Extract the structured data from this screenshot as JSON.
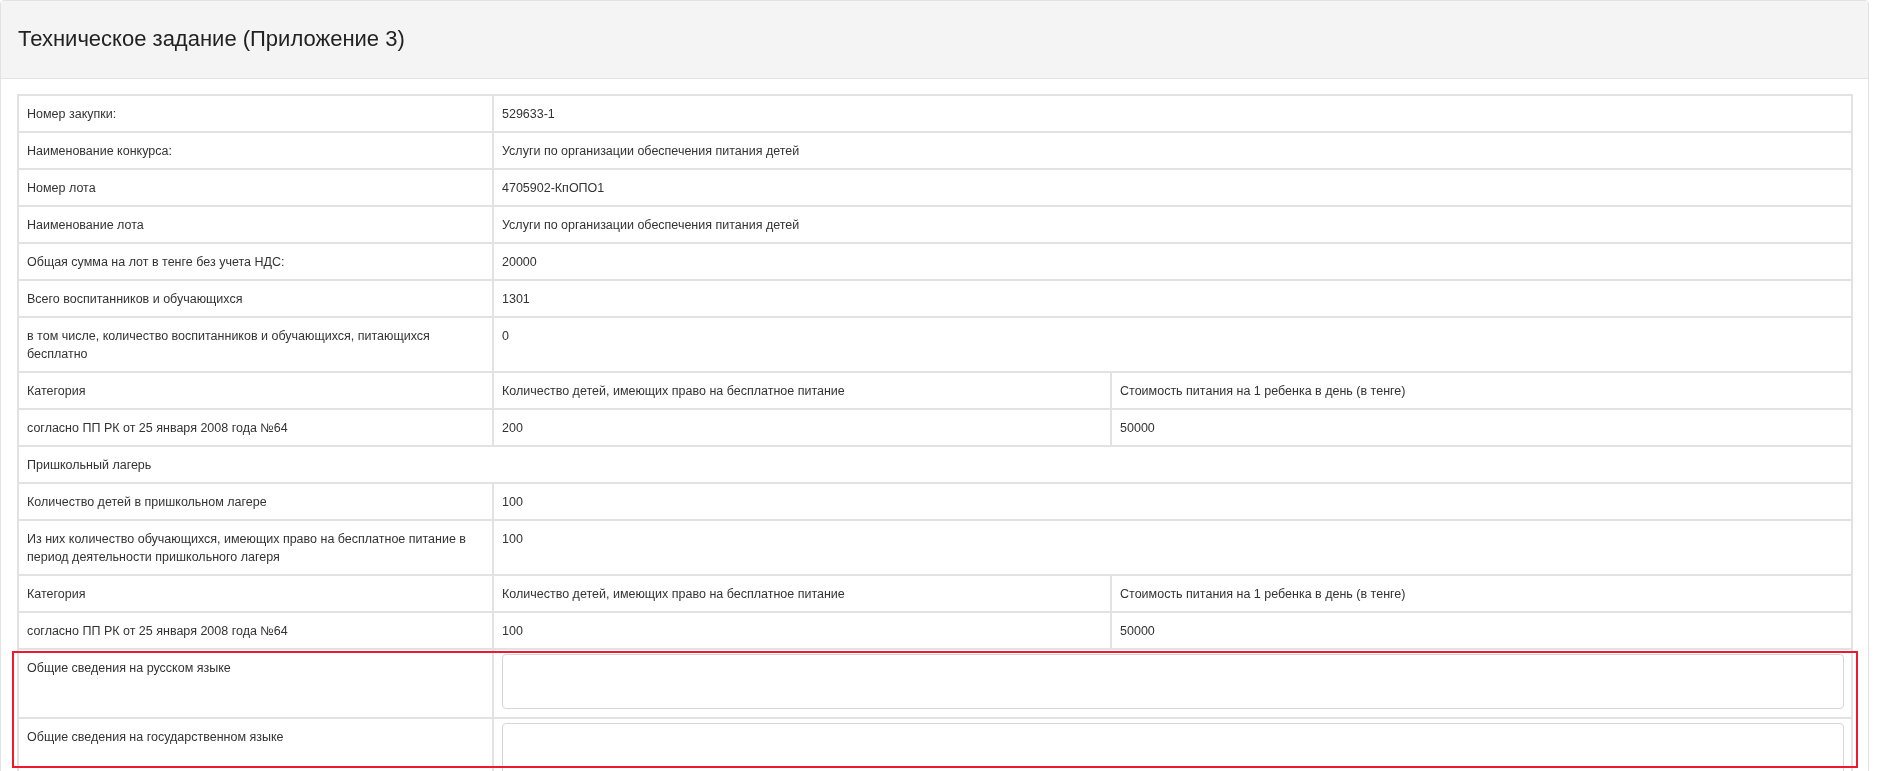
{
  "card": {
    "title": "Техническое задание (Приложение 3)"
  },
  "rows": [
    {
      "kind": "pair",
      "cells": [
        "Номер закупки:",
        "529633-1"
      ]
    },
    {
      "kind": "pair",
      "cells": [
        "Наименование конкурса:",
        "Услуги по организации обеспечения питания детей"
      ]
    },
    {
      "kind": "pair",
      "cells": [
        "Номер лота",
        "4705902-КпОПО1"
      ]
    },
    {
      "kind": "pair",
      "cells": [
        "Наименование лота",
        "Услуги по организации обеспечения питания детей"
      ]
    },
    {
      "kind": "pair",
      "cells": [
        "Общая сумма на лот в тенге без учета НДС:",
        "20000"
      ]
    },
    {
      "kind": "pair",
      "cells": [
        "Всего воспитанников и обучающихся",
        "1301"
      ]
    },
    {
      "kind": "pair",
      "cells": [
        "в том числе, количество воспитанников и обучающихся, питающихся бесплатно",
        "0"
      ]
    },
    {
      "kind": "triple",
      "cells": [
        "Категория",
        "Количество детей, имеющих право на бесплатное питание",
        "Стоимость питания на 1 ребенка в день (в тенге)"
      ]
    },
    {
      "kind": "triple",
      "cells": [
        "согласно ПП РК от 25 января 2008 года №64",
        "200",
        "50000"
      ]
    },
    {
      "kind": "section",
      "cells": [
        "Пришкольный лагерь"
      ]
    },
    {
      "kind": "pair",
      "cells": [
        "Количество детей в пришкольном лагере",
        "100"
      ]
    },
    {
      "kind": "pair",
      "cells": [
        "Из них количество обучающихся, имеющих право на бесплатное питание в период деятельности пришкольного лагеря",
        "100"
      ]
    },
    {
      "kind": "triple",
      "cells": [
        "Категория",
        "Количество детей, имеющих право на бесплатное питание",
        "Стоимость питания на 1 ребенка в день (в тенге)"
      ]
    },
    {
      "kind": "triple",
      "cells": [
        "согласно ПП РК от 25 января 2008 года №64",
        "100",
        "50000"
      ]
    },
    {
      "kind": "field",
      "highlighted": true,
      "cells": [
        "Общие сведения на русском языке"
      ]
    },
    {
      "kind": "field",
      "highlighted": true,
      "cells": [
        "Общие сведения на государственном языке"
      ]
    }
  ]
}
